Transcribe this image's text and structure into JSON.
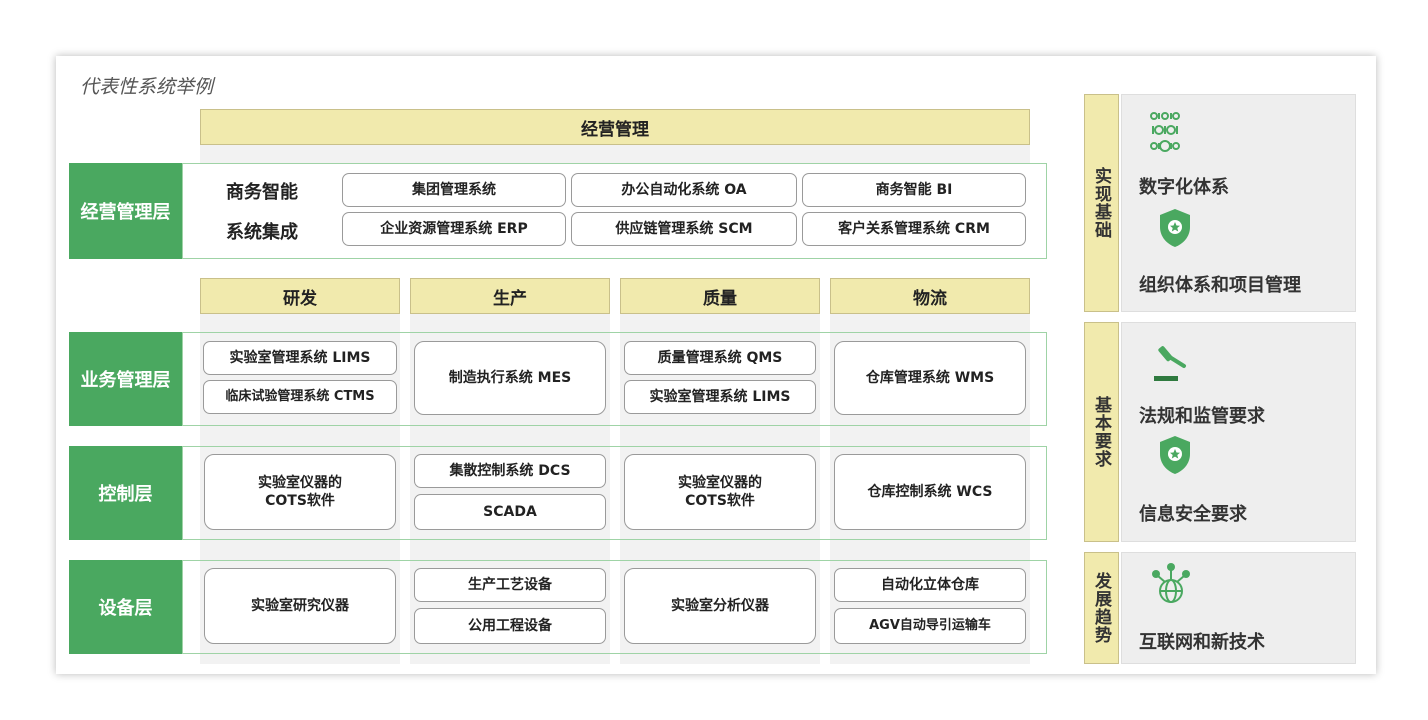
{
  "title": "代表性系统举例",
  "top_header": "经营管理",
  "layers": {
    "business_mgmt": "经营管理层",
    "operations": "业务管理层",
    "control": "控制层",
    "equipment": "设备层"
  },
  "bi": {
    "row1_label": "商务智能",
    "row2_label": "系统集成",
    "systems": [
      "集团管理系统",
      "办公自动化系统 OA",
      "商务智能 BI",
      "企业资源管理系统 ERP",
      "供应链管理系统 SCM",
      "客户关系管理系统 CRM"
    ]
  },
  "columns": [
    "研发",
    "生产",
    "质量",
    "物流"
  ],
  "operations_cells": {
    "rd": [
      "实验室管理系统 LIMS",
      "临床试验管理系统 CTMS"
    ],
    "production": "制造执行系统 MES",
    "quality": [
      "质量管理系统 QMS",
      "实验室管理系统 LIMS"
    ],
    "logistics": "仓库管理系统 WMS"
  },
  "control_cells": {
    "rd": "实验室仪器的\nCOTS软件",
    "production": [
      "集散控制系统 DCS",
      "SCADA"
    ],
    "quality": "实验室仪器的\nCOTS软件",
    "logistics": "仓库控制系统 WCS"
  },
  "equipment_cells": {
    "rd": "实验室研究仪器",
    "production": [
      "生产工艺设备",
      "公用工程设备"
    ],
    "quality": "实验室分析仪器",
    "logistics": [
      "自动化立体仓库",
      "AGV自动导引运输车"
    ]
  },
  "side": [
    {
      "tab": "实现基础",
      "items": [
        "数字化体系",
        "组织体系和项目管理"
      ],
      "icons": [
        "digital-binary-icon",
        "shield-star-icon"
      ]
    },
    {
      "tab": "基本要求",
      "items": [
        "法规和监管要求",
        "信息安全要求"
      ],
      "icons": [
        "gavel-icon",
        "shield-star-icon"
      ]
    },
    {
      "tab": "发展趋势",
      "items": [
        "互联网和新技术"
      ],
      "icons": [
        "globe-network-icon"
      ]
    }
  ],
  "colors": {
    "layer_green": "#4aa860",
    "header_yellow": "#f1eaad",
    "band_border": "#9fd3a6",
    "icon_green": "#4aa860"
  }
}
